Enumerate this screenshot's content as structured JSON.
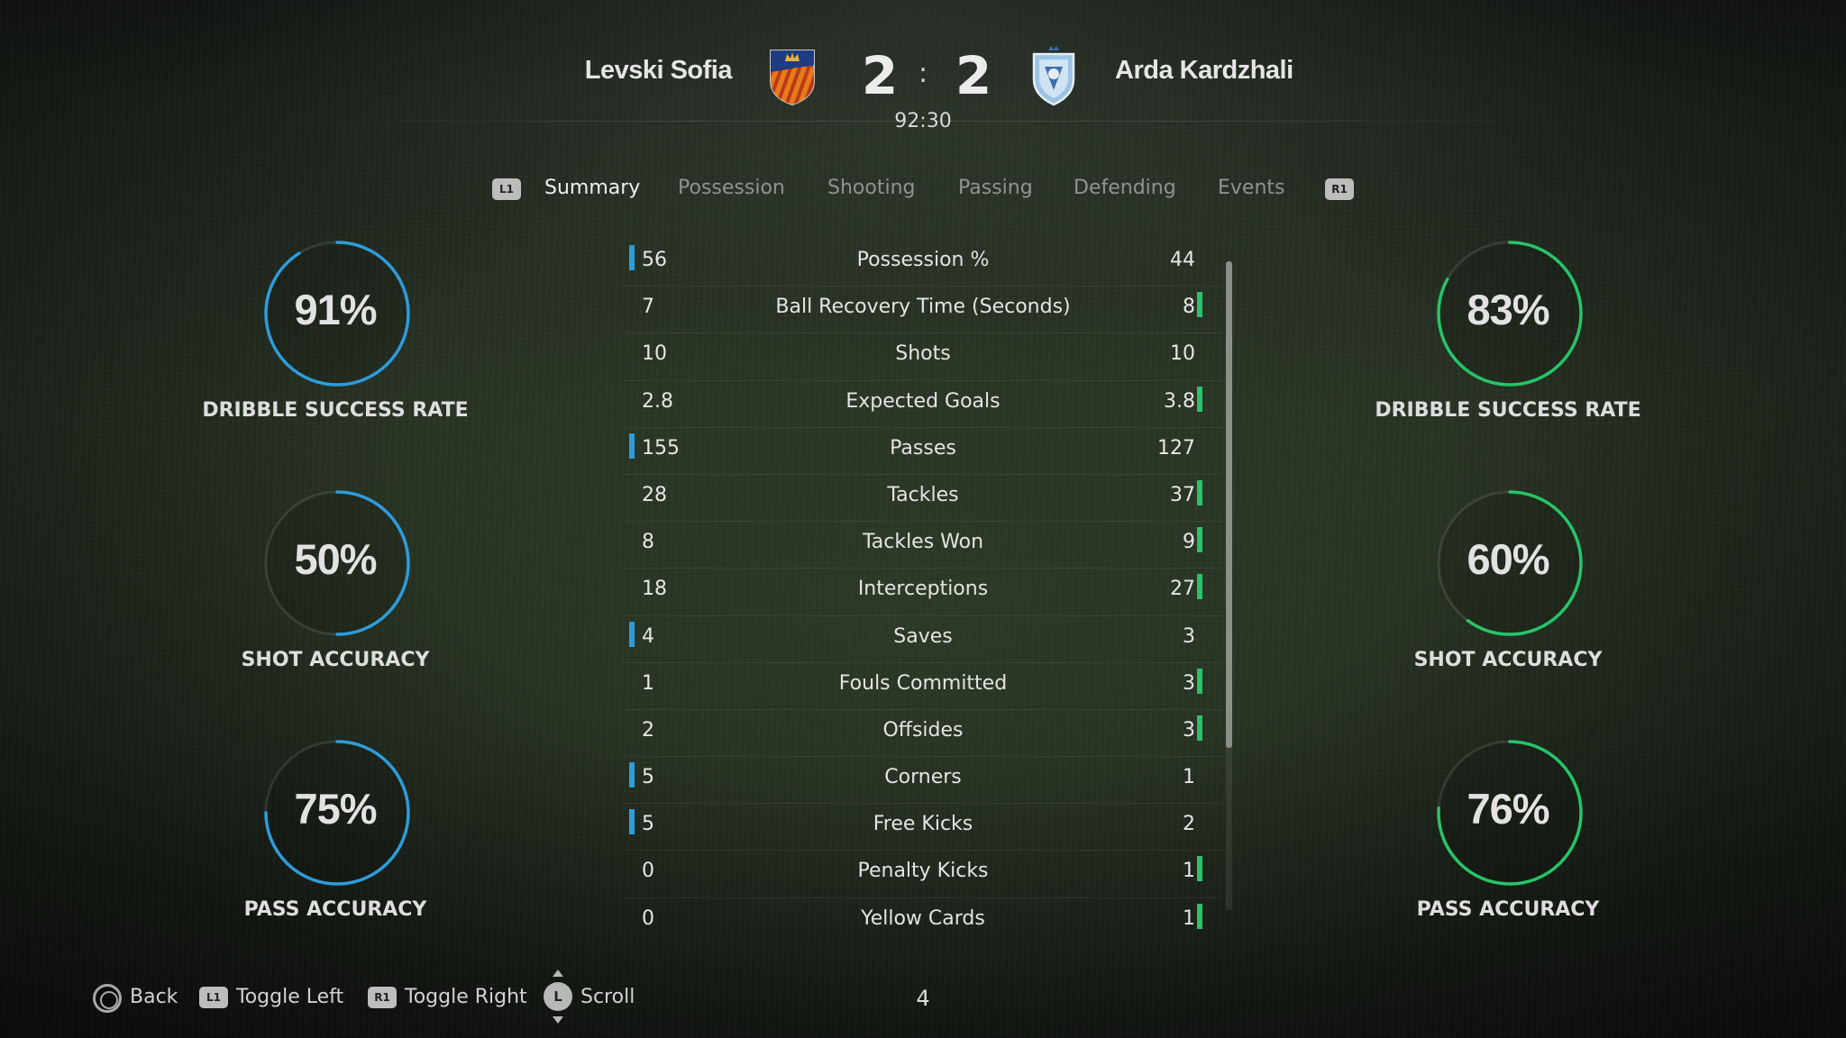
{
  "header": {
    "home_team": "Levski Sofia",
    "away_team": "Arda Kardzhali",
    "home_score": "2",
    "away_score": "2",
    "separator": ":",
    "clock": "92:30",
    "home_crest_icon": "levski-crest-icon",
    "away_crest_icon": "arda-crest-icon"
  },
  "tabs": {
    "left_button": "L1",
    "right_button": "R1",
    "items": [
      {
        "label": "Summary",
        "active": true
      },
      {
        "label": "Possession",
        "active": false
      },
      {
        "label": "Shooting",
        "active": false
      },
      {
        "label": "Passing",
        "active": false
      },
      {
        "label": "Defending",
        "active": false
      },
      {
        "label": "Events",
        "active": false
      }
    ]
  },
  "home_rings": [
    {
      "value": "91%",
      "fraction": 0.91,
      "label": "DRIBBLE SUCCESS RATE"
    },
    {
      "value": "50%",
      "fraction": 0.5,
      "label": "SHOT ACCURACY"
    },
    {
      "value": "75%",
      "fraction": 0.75,
      "label": "PASS ACCURACY"
    }
  ],
  "away_rings": [
    {
      "value": "83%",
      "fraction": 0.83,
      "label": "DRIBBLE SUCCESS RATE"
    },
    {
      "value": "60%",
      "fraction": 0.6,
      "label": "SHOT ACCURACY"
    },
    {
      "value": "76%",
      "fraction": 0.76,
      "label": "PASS ACCURACY"
    }
  ],
  "stats": [
    {
      "label": "Possession %",
      "home": "56",
      "away": "44",
      "leader": "home"
    },
    {
      "label": "Ball Recovery Time (Seconds)",
      "home": "7",
      "away": "8",
      "leader": "away"
    },
    {
      "label": "Shots",
      "home": "10",
      "away": "10",
      "leader": "none"
    },
    {
      "label": "Expected Goals",
      "home": "2.8",
      "away": "3.8",
      "leader": "away"
    },
    {
      "label": "Passes",
      "home": "155",
      "away": "127",
      "leader": "home"
    },
    {
      "label": "Tackles",
      "home": "28",
      "away": "37",
      "leader": "away"
    },
    {
      "label": "Tackles Won",
      "home": "8",
      "away": "9",
      "leader": "away"
    },
    {
      "label": "Interceptions",
      "home": "18",
      "away": "27",
      "leader": "away"
    },
    {
      "label": "Saves",
      "home": "4",
      "away": "3",
      "leader": "home"
    },
    {
      "label": "Fouls Committed",
      "home": "1",
      "away": "3",
      "leader": "away"
    },
    {
      "label": "Offsides",
      "home": "2",
      "away": "3",
      "leader": "away"
    },
    {
      "label": "Corners",
      "home": "5",
      "away": "1",
      "leader": "home"
    },
    {
      "label": "Free Kicks",
      "home": "5",
      "away": "2",
      "leader": "home"
    },
    {
      "label": "Penalty Kicks",
      "home": "0",
      "away": "1",
      "leader": "away"
    },
    {
      "label": "Yellow Cards",
      "home": "0",
      "away": "1",
      "leader": "away"
    }
  ],
  "footer": {
    "back_label": "Back",
    "toggle_left_label": "Toggle Left",
    "toggle_left_button": "L1",
    "toggle_right_label": "Toggle Right",
    "toggle_right_button": "R1",
    "scroll_label": "Scroll",
    "scroll_button": "L",
    "page_number": "4"
  },
  "colors": {
    "home_accent": "#2d9cdb",
    "away_accent": "#27c468"
  }
}
